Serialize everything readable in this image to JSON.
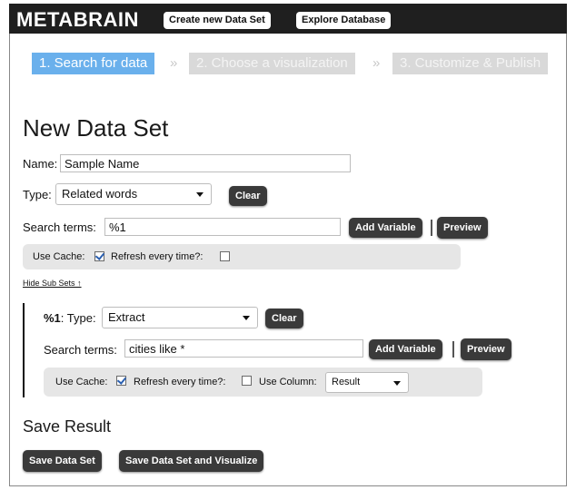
{
  "header": {
    "logo": "METABRAIN",
    "create_button": "Create new Data Set",
    "explore_button": "Explore Database"
  },
  "steps": {
    "step1": "1. Search for data",
    "step2": "2. Choose a visualization",
    "step3": "3. Customize & Publish",
    "separator": "»"
  },
  "form": {
    "title": "New Data Set",
    "name_label": "Name:",
    "name_value": "Sample Name",
    "type_label": "Type:",
    "type_value": "Related words",
    "clear_label": "Clear",
    "search_label": "Search terms:",
    "search_value": "%1",
    "add_variable_label": "Add Variable",
    "pipe": "|",
    "preview_label": "Preview",
    "use_cache_label": "Use Cache:",
    "use_cache_checked": true,
    "refresh_label": "Refresh every time?:",
    "refresh_checked": false,
    "hide_subsets_link": "Hide Sub Sets ↑"
  },
  "subset": {
    "var_name": "%1",
    "type_label": ": Type:",
    "type_value": "Extract",
    "clear_label": "Clear",
    "search_label": "Search terms:",
    "search_value": "cities like *",
    "add_variable_label": "Add Variable",
    "pipe": "|",
    "preview_label": "Preview",
    "use_cache_label": "Use Cache:",
    "use_cache_checked": true,
    "refresh_label": "Refresh every time?:",
    "refresh_checked": false,
    "use_column_label": "Use Column:",
    "use_column_value": "Result"
  },
  "save": {
    "title": "Save Result",
    "save_button": "Save Data Set",
    "save_visualize_button": "Save Data Set and Visualize"
  }
}
